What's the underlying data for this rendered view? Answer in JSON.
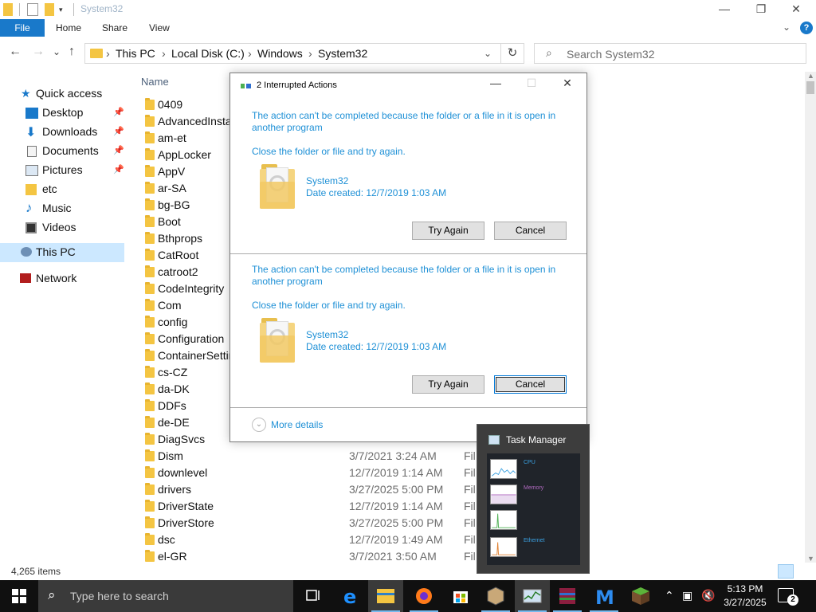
{
  "window": {
    "title": "System32",
    "minimize": "—",
    "maximize": "❐",
    "close": "✕"
  },
  "ribbon": {
    "tabs": [
      "File",
      "Home",
      "Share",
      "View"
    ],
    "help": "?",
    "collapse": "⌄"
  },
  "navigation": {
    "back": "←",
    "forward": "→",
    "recent": "⌄",
    "up": "↑",
    "path": [
      "This PC",
      "Local Disk (C:)",
      "Windows",
      "System32"
    ],
    "path_separator": "›",
    "dropdown": "⌄",
    "refresh": "↻",
    "search_placeholder": "Search System32"
  },
  "sidebar": {
    "items": [
      {
        "label": "Quick access",
        "icon": "star-icon",
        "pinned": false
      },
      {
        "label": "Desktop",
        "icon": "desktop-icon",
        "pinned": true
      },
      {
        "label": "Downloads",
        "icon": "download-icon",
        "pinned": true
      },
      {
        "label": "Documents",
        "icon": "documents-icon",
        "pinned": true
      },
      {
        "label": "Pictures",
        "icon": "pictures-icon",
        "pinned": true
      },
      {
        "label": "etc",
        "icon": "folder-icon",
        "pinned": false
      },
      {
        "label": "Music",
        "icon": "music-icon",
        "pinned": false
      },
      {
        "label": "Videos",
        "icon": "videos-icon",
        "pinned": false
      },
      {
        "label": "This PC",
        "icon": "computer-icon",
        "pinned": false
      },
      {
        "label": "Network",
        "icon": "network-icon",
        "pinned": false
      }
    ],
    "pin_glyph": "📌"
  },
  "filelist": {
    "column_name": "Name",
    "rows": [
      {
        "name": "0409",
        "date": "",
        "type": ""
      },
      {
        "name": "AdvancedInstallers",
        "date": "",
        "type": ""
      },
      {
        "name": "am-et",
        "date": "",
        "type": ""
      },
      {
        "name": "AppLocker",
        "date": "",
        "type": ""
      },
      {
        "name": "AppV",
        "date": "",
        "type": ""
      },
      {
        "name": "ar-SA",
        "date": "",
        "type": ""
      },
      {
        "name": "bg-BG",
        "date": "",
        "type": ""
      },
      {
        "name": "Boot",
        "date": "",
        "type": ""
      },
      {
        "name": "Bthprops",
        "date": "",
        "type": ""
      },
      {
        "name": "CatRoot",
        "date": "",
        "type": ""
      },
      {
        "name": "catroot2",
        "date": "",
        "type": ""
      },
      {
        "name": "CodeIntegrity",
        "date": "",
        "type": ""
      },
      {
        "name": "Com",
        "date": "",
        "type": ""
      },
      {
        "name": "config",
        "date": "",
        "type": ""
      },
      {
        "name": "Configuration",
        "date": "",
        "type": ""
      },
      {
        "name": "ContainerSettings",
        "date": "",
        "type": ""
      },
      {
        "name": "cs-CZ",
        "date": "",
        "type": ""
      },
      {
        "name": "da-DK",
        "date": "",
        "type": ""
      },
      {
        "name": "DDFs",
        "date": "",
        "type": ""
      },
      {
        "name": "de-DE",
        "date": "",
        "type": ""
      },
      {
        "name": "DiagSvcs",
        "date": "",
        "type": ""
      },
      {
        "name": "Dism",
        "date": "3/7/2021 3:24 AM",
        "type": "File"
      },
      {
        "name": "downlevel",
        "date": "12/7/2019 1:14 AM",
        "type": "File"
      },
      {
        "name": "drivers",
        "date": "3/27/2025 5:00 PM",
        "type": "File"
      },
      {
        "name": "DriverState",
        "date": "12/7/2019 1:14 AM",
        "type": "File"
      },
      {
        "name": "DriverStore",
        "date": "3/27/2025 5:00 PM",
        "type": "File"
      },
      {
        "name": "dsc",
        "date": "12/7/2019 1:49 AM",
        "type": "File"
      },
      {
        "name": "el-GR",
        "date": "3/7/2021 3:50 AM",
        "type": "File"
      }
    ]
  },
  "status": {
    "item_count": "4,265 items"
  },
  "dialog": {
    "title": "2 Interrupted Actions",
    "minimize": "—",
    "maximize": "☐",
    "close": "✕",
    "actions": [
      {
        "message": "The action can't be completed because the folder or a file in it is open in another program",
        "hint": "Close the folder or file and try again.",
        "file_name": "System32",
        "file_date": "Date created: 12/7/2019 1:03 AM",
        "try_again": "Try Again",
        "cancel": "Cancel"
      },
      {
        "message": "The action can't be completed because the folder or a file in it is open in another program",
        "hint": "Close the folder or file and try again.",
        "file_name": "System32",
        "file_date": "Date created: 12/7/2019 1:03 AM",
        "try_again": "Try Again",
        "cancel": "Cancel"
      }
    ],
    "more_details": "More details",
    "more_chevron": "⌄"
  },
  "taskmanager_popup": {
    "title": "Task Manager",
    "rows": [
      {
        "label": "CPU",
        "sub": "",
        "color": "#3aa0e0"
      },
      {
        "label": "Memory",
        "sub": "",
        "color": "#b06ac0"
      },
      {
        "label": "",
        "sub": "",
        "color": "#4caf50"
      },
      {
        "label": "Ethernet",
        "sub": "",
        "color": "#e08030"
      }
    ]
  },
  "taskbar": {
    "search_placeholder": "Type here to search",
    "time": "5:13 PM",
    "date": "3/27/2025",
    "notification_count": "2",
    "apps": [
      "task-view",
      "edge",
      "file-explorer",
      "firefox",
      "store",
      "app-box",
      "task-manager",
      "winrar",
      "malwarebytes",
      "minecraft"
    ]
  },
  "colors": {
    "accent": "#1979ca",
    "dialog_text": "#1e90d6",
    "folder": "#f4c542",
    "selection": "#cce8ff",
    "taskbar": "#101010"
  }
}
